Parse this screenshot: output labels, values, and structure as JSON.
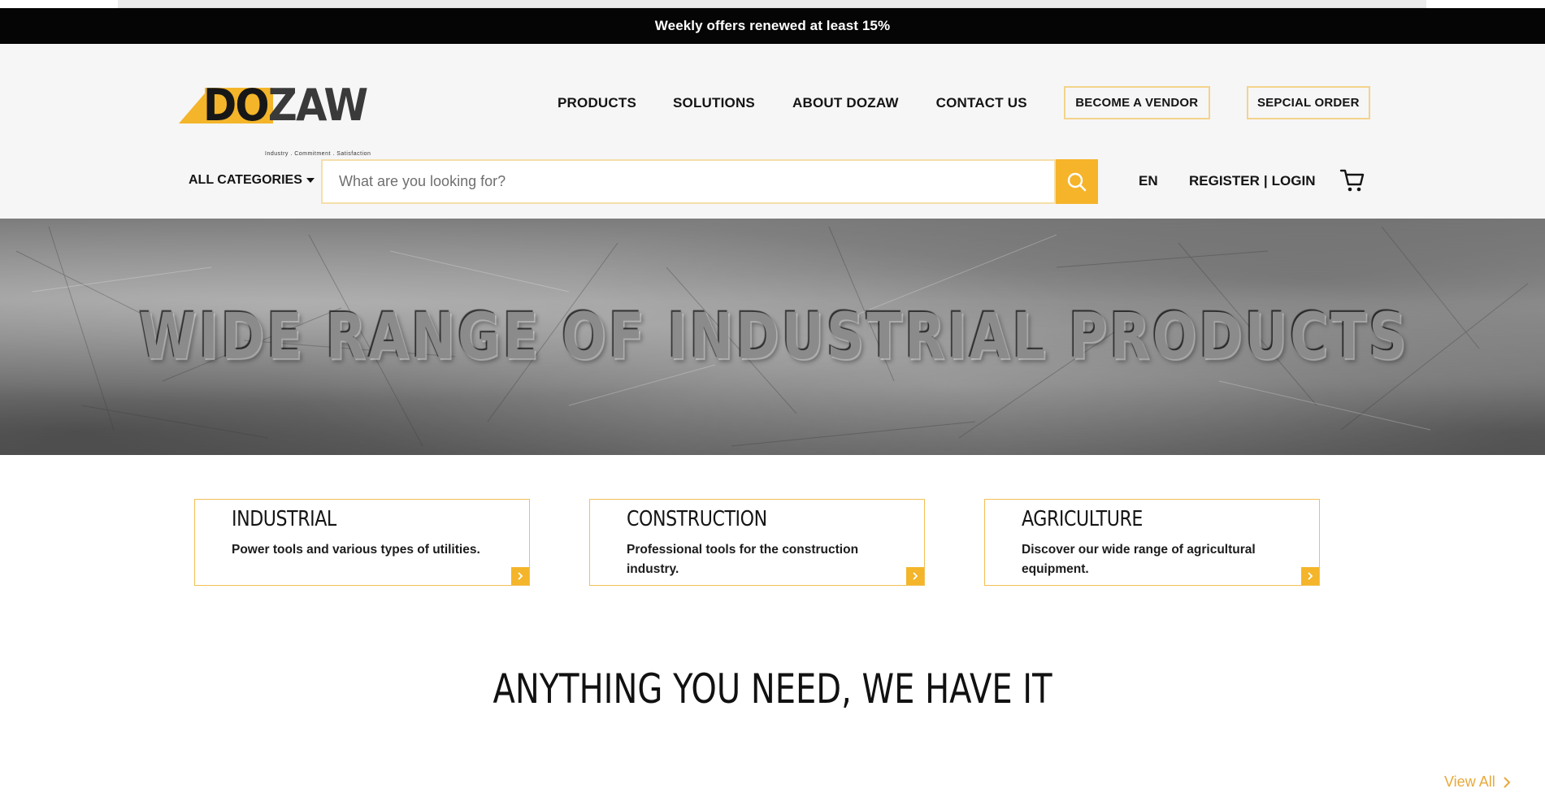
{
  "announcement": {
    "text": "Weekly offers renewed at least 15%"
  },
  "logo": {
    "text_dark": "DO",
    "text_light": "ZAW",
    "tagline": "Industry . Commitment . Satisfaction"
  },
  "nav": {
    "items": [
      {
        "label": "PRODUCTS"
      },
      {
        "label": "SOLUTIONS"
      },
      {
        "label": "ABOUT DOZAW"
      },
      {
        "label": "CONTACT US"
      }
    ],
    "vendor_button": "BECOME A VENDOR",
    "special_order_button": "SEPCIAL ORDER"
  },
  "search": {
    "categories_label": "ALL CATEGORIES",
    "placeholder": "What are you looking for?",
    "value": ""
  },
  "account": {
    "language": "EN",
    "register": "REGISTER",
    "separator": "|",
    "login": "LOGIN"
  },
  "hero": {
    "text": "WIDE RANGE OF INDUSTRIAL PRODUCTS"
  },
  "cards": [
    {
      "title": "INDUSTRIAL",
      "description": "Power tools and various types of utilities."
    },
    {
      "title": "CONSTRUCTION",
      "description": "Professional tools for the construction industry."
    },
    {
      "title": "AGRICULTURE",
      "description": "Discover our wide range of agricultural equipment."
    }
  ],
  "section": {
    "title": "ANYTHING YOU NEED, WE HAVE IT",
    "view_all": "View All"
  },
  "colors": {
    "accent": "#f4b52a",
    "accent_light": "#f3d38b",
    "announcement_bg": "#050505",
    "header_bg": "#f6f6f6",
    "view_all": "#e8a93a"
  },
  "icons": {
    "search": "search-icon",
    "cart": "cart-icon",
    "caret": "caret-down-icon",
    "card_arrow": "chevron-right-icon"
  }
}
